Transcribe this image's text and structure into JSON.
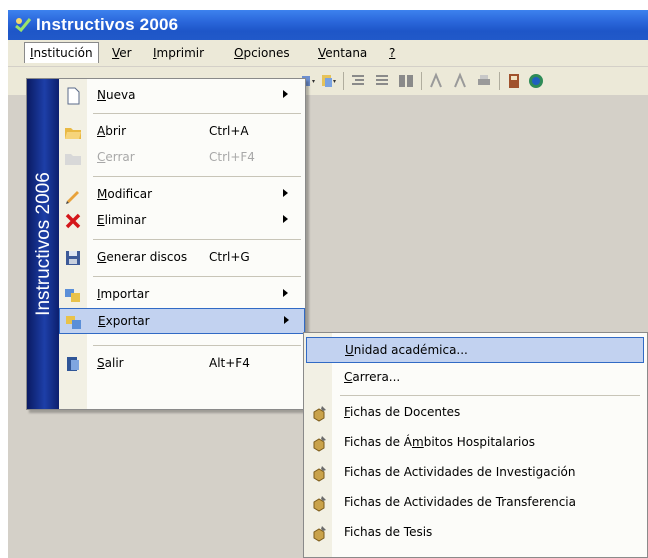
{
  "window": {
    "title": "Instructivos 2006"
  },
  "menubar": [
    {
      "label": "Institución",
      "key": "I"
    },
    {
      "label": "Ver",
      "key": "V"
    },
    {
      "label": "Imprimir",
      "key": "I"
    },
    {
      "label": "Opciones",
      "key": "O"
    },
    {
      "label": "Ventana",
      "key": "V"
    },
    {
      "label": "?",
      "key": "?"
    }
  ],
  "menu": {
    "banner": "Instructivos 2006",
    "items": [
      {
        "label": "Nueva",
        "shortcut": "",
        "submenu": true,
        "icon": "new-document-icon"
      },
      {
        "label": "Abrir",
        "shortcut": "Ctrl+A",
        "submenu": false,
        "icon": "open-folder-icon"
      },
      {
        "label": "Cerrar",
        "shortcut": "Ctrl+F4",
        "submenu": false,
        "disabled": true,
        "icon": "close-document-icon"
      },
      {
        "label": "Modificar",
        "shortcut": "",
        "submenu": true,
        "icon": "pencil-icon"
      },
      {
        "label": "Eliminar",
        "shortcut": "",
        "submenu": true,
        "icon": "delete-x-icon"
      },
      {
        "label": "Generar discos",
        "shortcut": "Ctrl+G",
        "submenu": false,
        "icon": "floppy-disk-icon"
      },
      {
        "label": "Importar",
        "shortcut": "",
        "submenu": true,
        "icon": "import-icon"
      },
      {
        "label": "Exportar",
        "shortcut": "",
        "submenu": true,
        "highlighted": true,
        "icon": "export-icon"
      },
      {
        "label": "Salir",
        "shortcut": "Alt+F4",
        "submenu": false,
        "icon": "exit-door-icon"
      }
    ]
  },
  "submenu": {
    "items": [
      {
        "label": "Unidad académica...",
        "highlighted": true
      },
      {
        "label": "Carrera..."
      },
      {
        "label": "Fichas de Docentes",
        "icon": "wrench-cube-icon"
      },
      {
        "label": "Fichas de Ámbitos Hospitalarios",
        "icon": "wrench-cube-icon"
      },
      {
        "label": "Fichas de Actividades de Investigación",
        "icon": "wrench-cube-icon"
      },
      {
        "label": "Fichas de Actividades de Transferencia",
        "icon": "wrench-cube-icon"
      },
      {
        "label": "Fichas de Tesis",
        "icon": "wrench-cube-icon"
      }
    ]
  },
  "colors": {
    "title_bar": "#2a66da",
    "menu_highlight": "#c2d2f0",
    "banner": "#1d3fa8",
    "client_area": "#d4d0c8"
  }
}
